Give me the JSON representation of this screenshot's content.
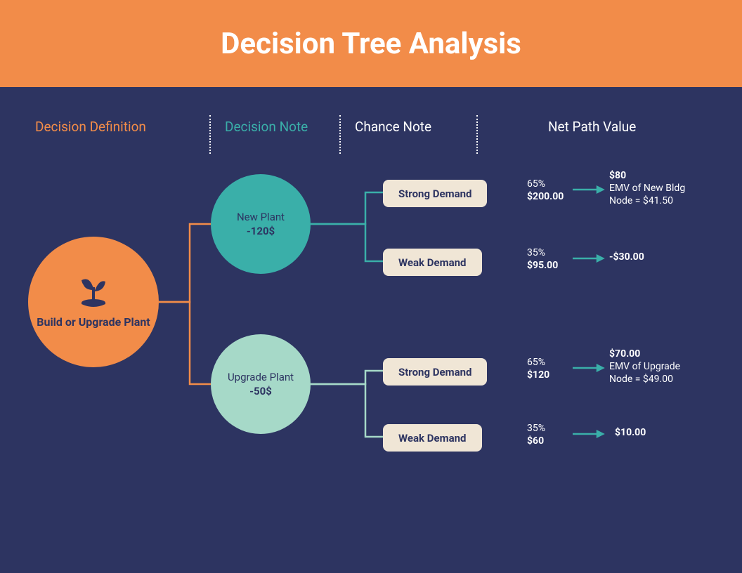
{
  "title": "Decision Tree Analysis",
  "legend": {
    "col1": "Decision Definition",
    "col2": "Decision Note",
    "col3": "Chance Note",
    "col4": "Net Path Value"
  },
  "root": {
    "label": "Build or Upgrade Plant"
  },
  "decisions": {
    "new_plant": {
      "name": "New Plant",
      "cost": "-120$"
    },
    "upgrade_plant": {
      "name": "Upgrade Plant",
      "cost": "-50$"
    }
  },
  "chances": {
    "c1": "Strong Demand",
    "c2": "Weak Demand",
    "c3": "Strong Demand",
    "c4": "Weak Demand"
  },
  "values": {
    "v1": {
      "pct": "65%",
      "amt": "$200.00"
    },
    "v2": {
      "pct": "35%",
      "amt": "$95.00"
    },
    "v3": {
      "pct": "65%",
      "amt": "$120"
    },
    "v4": {
      "pct": "35%",
      "amt": "$60"
    }
  },
  "results": {
    "r1": {
      "main": "$80",
      "sub1": "EMV of New Bldg",
      "sub2": "Node = $41.50"
    },
    "r2": {
      "main": "-$30.00"
    },
    "r3": {
      "main": "$70.00",
      "sub1": "EMV of Upgrade",
      "sub2": "Node = $49.00"
    },
    "r4": {
      "main": "$10.00"
    }
  },
  "colors": {
    "orange": "#f28c49",
    "teal": "#3aafa9",
    "mint": "#a6d9c8",
    "navy": "#2d3461",
    "cream": "#f0e6d6"
  }
}
